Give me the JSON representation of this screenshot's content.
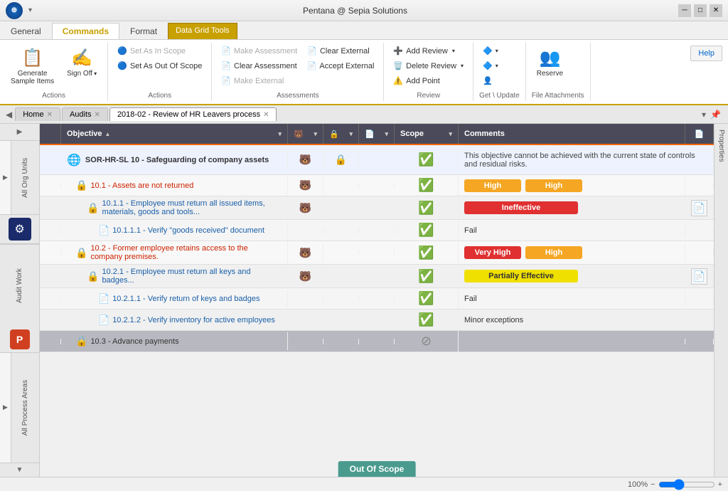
{
  "app": {
    "title": "Pentana @ Sepia Solutions",
    "icon": "P"
  },
  "window_controls": {
    "minimize": "─",
    "maximize": "□",
    "close": "✕"
  },
  "ribbon": {
    "tabs": [
      {
        "label": "General",
        "active": false
      },
      {
        "label": "Commands",
        "active": true
      },
      {
        "label": "Format",
        "active": false
      }
    ],
    "data_grid_tools": "Data Grid Tools",
    "help": "Help",
    "groups": {
      "actions1": {
        "label": "Actions",
        "buttons": [
          {
            "label": "Generate\nSample Items",
            "icon": "📋"
          },
          {
            "label": "Sign\nOff",
            "icon": "✍️"
          }
        ]
      },
      "scope_actions": {
        "label": "Actions",
        "buttons_small": [
          {
            "label": "Set As In Scope",
            "disabled": true,
            "icon": "🔵"
          },
          {
            "label": "Set As Out Of Scope",
            "disabled": false,
            "icon": "🔵"
          }
        ]
      },
      "assessments": {
        "label": "Assessments",
        "buttons": [
          {
            "label": "Make Assessment",
            "disabled": true,
            "icon": "📄"
          },
          {
            "label": "Clear Assessment",
            "disabled": false,
            "icon": "📄"
          },
          {
            "label": "Make External",
            "disabled": true,
            "icon": "📄"
          },
          {
            "label": "Clear External",
            "disabled": false,
            "icon": "📄"
          },
          {
            "label": "Accept External",
            "disabled": false,
            "icon": "📄"
          }
        ]
      },
      "review": {
        "label": "Review",
        "buttons": [
          {
            "label": "Add Review",
            "icon": "➕"
          },
          {
            "label": "Delete Review",
            "icon": "🗑️"
          },
          {
            "label": "Add Point",
            "icon": "➕"
          }
        ]
      },
      "get_update": {
        "label": "Get \\ Update",
        "buttons": []
      },
      "file_attachments": {
        "label": "File Attachments",
        "buttons": [
          {
            "label": "Reserve",
            "icon": "📌"
          }
        ]
      }
    }
  },
  "tabs": [
    {
      "label": "Home",
      "closeable": true
    },
    {
      "label": "Audits",
      "closeable": true
    },
    {
      "label": "2018-02 - Review of HR Leavers process",
      "closeable": true,
      "active": true
    }
  ],
  "grid": {
    "headers": [
      {
        "label": "",
        "sortable": false
      },
      {
        "label": "Objective",
        "sortable": true,
        "filterable": true
      },
      {
        "label": "🐻",
        "sortable": false,
        "filterable": true
      },
      {
        "label": "🔒",
        "sortable": false,
        "filterable": true
      },
      {
        "label": "📄",
        "sortable": false,
        "filterable": true
      },
      {
        "label": "Scope",
        "sortable": false,
        "filterable": true
      },
      {
        "label": "Comments",
        "sortable": false
      },
      {
        "label": "📄",
        "sortable": false
      }
    ],
    "rows": [
      {
        "id": "sor-hr",
        "level": 0,
        "indent": 0,
        "icon": "🏠",
        "icon_type": "globe",
        "label": "SOR-HR-SL 10 - Safeguarding of company assets",
        "col3": "🐻",
        "col4": "🔒",
        "col5": "",
        "scope": "check",
        "comments": "This objective cannot be achieved with the current state of controls and residual risks.",
        "badge1": null,
        "badge2": null,
        "type": "main"
      },
      {
        "id": "10.1",
        "level": 1,
        "indent": 1,
        "icon": "🔒",
        "icon_type": "lock",
        "label": "10.1 - Assets are not returned",
        "col3": "🐻",
        "col4": "",
        "col5": "",
        "scope": "check",
        "comments": "",
        "badge1": "High",
        "badge1_type": "high",
        "badge2": "High",
        "badge2_type": "high",
        "type": "sub1"
      },
      {
        "id": "10.1.1",
        "level": 2,
        "indent": 2,
        "icon": "🔒",
        "icon_type": "lock",
        "label": "10.1.1 - Employee must return all issued items, materials, goods and tools...",
        "col3": "🐻",
        "col4": "",
        "col5": "",
        "scope": "check",
        "comments": "",
        "badge1": "Ineffective",
        "badge1_type": "ineffective",
        "badge2": null,
        "type": "sub2",
        "has_doc": true
      },
      {
        "id": "10.1.1.1",
        "level": 3,
        "indent": 3,
        "icon": "📄",
        "icon_type": "doc",
        "label": "10.1.1.1 - Verify \"goods received\" document",
        "col3": "",
        "col4": "",
        "col5": "",
        "scope": "check",
        "comments": "Fail",
        "badge1": null,
        "badge2": null,
        "type": "sub3"
      },
      {
        "id": "10.2",
        "level": 1,
        "indent": 1,
        "icon": "🔒",
        "icon_type": "lock",
        "label": "10.2 - Former employee retains access to the company premises.",
        "col3": "🐻",
        "col4": "",
        "col5": "",
        "scope": "check",
        "comments": "",
        "badge1": "Very High",
        "badge1_type": "very-high",
        "badge2": "High",
        "badge2_type": "high",
        "type": "sub1"
      },
      {
        "id": "10.2.1",
        "level": 2,
        "indent": 2,
        "icon": "🔒",
        "icon_type": "lock",
        "label": "10.2.1 - Employee must return all keys and badges...",
        "col3": "🐻",
        "col4": "",
        "col5": "",
        "scope": "check",
        "comments": "",
        "badge1": "Partially Effective",
        "badge1_type": "partially",
        "badge2": null,
        "type": "sub2",
        "has_doc": true
      },
      {
        "id": "10.2.1.1",
        "level": 3,
        "indent": 3,
        "icon": "📄",
        "icon_type": "doc",
        "label": "10.2.1.1 - Verify return of keys and badges",
        "col3": "",
        "col4": "",
        "col5": "",
        "scope": "check",
        "comments": "Fail",
        "badge1": null,
        "badge2": null,
        "type": "sub3"
      },
      {
        "id": "10.2.1.2",
        "level": 3,
        "indent": 3,
        "icon": "📄",
        "icon_type": "doc",
        "label": "10.2.1.2 - Verify inventory for active employees",
        "col3": "",
        "col4": "",
        "col5": "",
        "scope": "check",
        "comments": "Minor exceptions",
        "badge1": null,
        "badge2": null,
        "type": "sub3"
      },
      {
        "id": "10.3",
        "level": 1,
        "indent": 1,
        "icon": "🔒",
        "icon_type": "lock",
        "label": "10.3 - Advance payments",
        "col3": "",
        "col4": "",
        "col5": "",
        "scope": "out",
        "comments": "",
        "badge1": null,
        "badge2": null,
        "type": "scope-out"
      }
    ]
  },
  "sidebar": {
    "left_labels": [
      "All Org Units",
      "Audit Work",
      "All Process Areas"
    ],
    "right_label": "Properties"
  },
  "status_bar": {
    "zoom": "100%",
    "zoom_value": 100
  },
  "out_of_scope_banner": "Out Of Scope"
}
